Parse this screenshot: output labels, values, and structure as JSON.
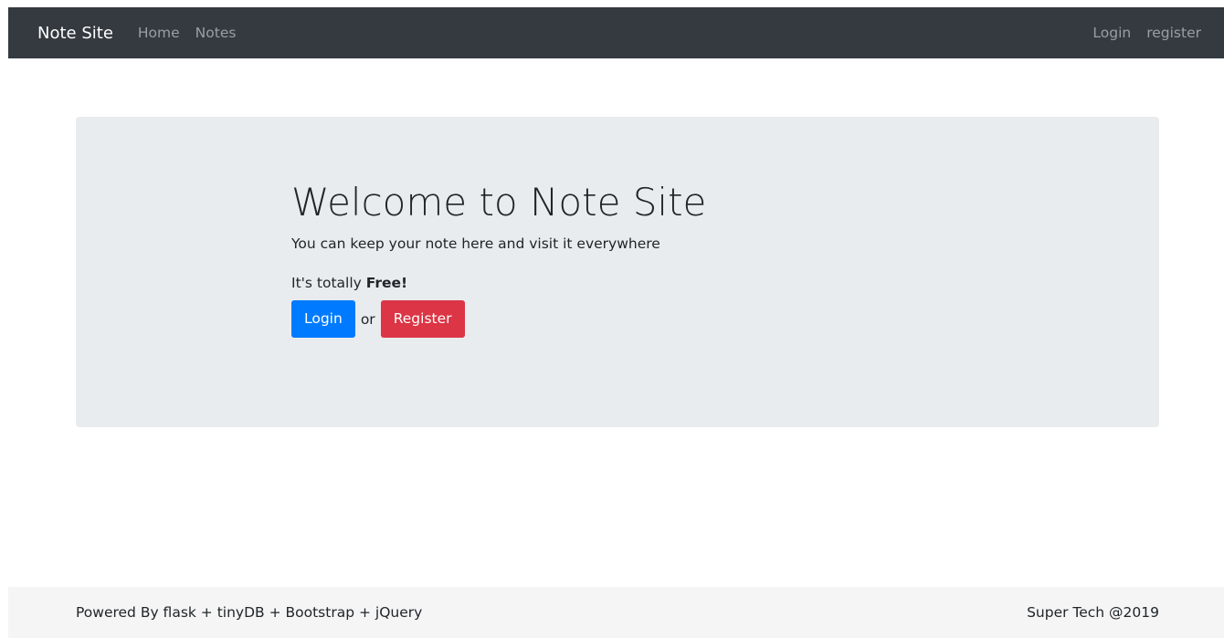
{
  "navbar": {
    "brand": "Note Site",
    "links": [
      "Home",
      "Notes"
    ],
    "right_links": [
      "Login",
      "register"
    ],
    "background": "#343a40"
  },
  "jumbotron": {
    "title": "Welcome to Note Site",
    "lead": "You can keep your note here and visit it everywhere",
    "free_prefix": "It's totally ",
    "free_bold": "Free!",
    "login_button": "Login",
    "or_text": "or",
    "register_button": "Register",
    "background": "#e9ecef"
  },
  "footer": {
    "left_text": "Powered By flask + tinyDB + Bootstrap + jQuery",
    "right_text": "Super Tech @2019"
  },
  "colors": {
    "primary": "#007bff",
    "danger": "#dc3545"
  }
}
